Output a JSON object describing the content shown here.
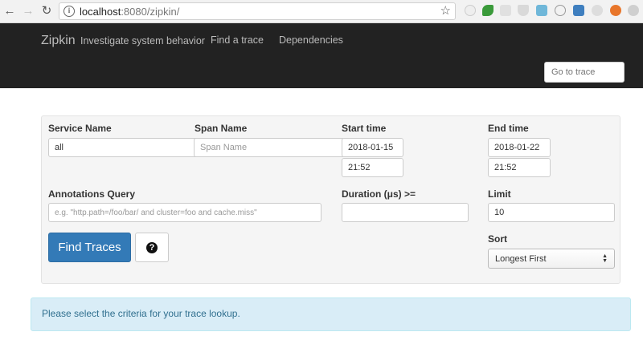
{
  "browser": {
    "url_host": "localhost",
    "url_rest": ":8080/zipkin/"
  },
  "navbar": {
    "brand": "Zipkin",
    "tagline": "Investigate system behavior",
    "links": [
      "Find a trace",
      "Dependencies"
    ],
    "goto_placeholder": "Go to trace"
  },
  "search": {
    "service_label": "Service Name",
    "service_value": "all",
    "span_label": "Span Name",
    "span_placeholder": "Span Name",
    "start_label": "Start time",
    "start_date": "2018-01-15",
    "start_time": "21:52",
    "end_label": "End time",
    "end_date": "2018-01-22",
    "end_time": "21:52",
    "annotations_label": "Annotations Query",
    "annotations_placeholder": "e.g. \"http.path=/foo/bar/ and cluster=foo and cache.miss\"",
    "duration_label": "Duration (μs) >=",
    "duration_value": "",
    "limit_label": "Limit",
    "limit_value": "10",
    "sort_label": "Sort",
    "sort_value": "Longest First",
    "find_button": "Find Traces"
  },
  "alert": {
    "message": "Please select the criteria for your trace lookup."
  },
  "colors": {
    "navbar_bg": "#222222",
    "primary_button": "#337ab7",
    "alert_bg": "#d9edf7",
    "alert_text": "#31708f"
  }
}
